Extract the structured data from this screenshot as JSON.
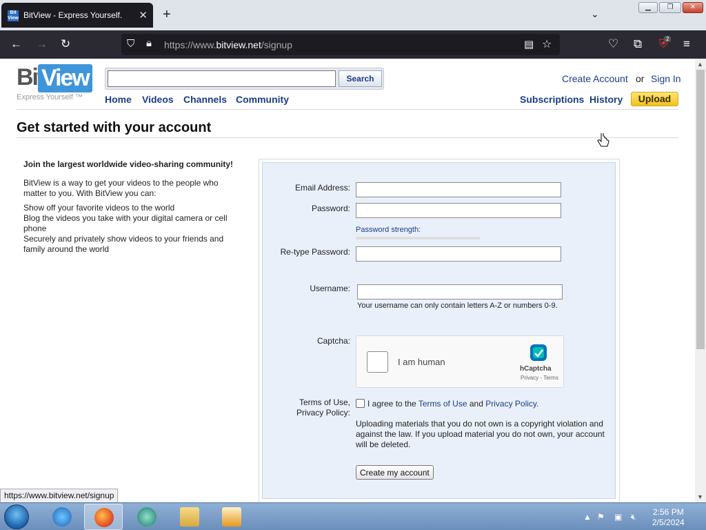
{
  "browser": {
    "tab_title": "BitView - Express Yourself.",
    "favicon_text": "BitView",
    "url_prefix": "https://www.",
    "url_domain": "bitview.net",
    "url_path": "/signup",
    "extension_badge": "2",
    "status_url": "https://www.bitview.net/signup"
  },
  "site": {
    "logo_bit": "Bit",
    "logo_view": "View",
    "logo_tagline": "Express Yourself ™",
    "search_button": "Search",
    "search_value": "",
    "nav": [
      "Home",
      "Videos",
      "Channels",
      "Community"
    ],
    "create_account": "Create Account",
    "or_text": "or",
    "sign_in": "Sign In",
    "subscriptions": "Subscriptions",
    "history": "History",
    "upload": "Upload"
  },
  "page": {
    "title": "Get started with your account",
    "intro_heading": "Join the largest worldwide video-sharing community!",
    "intro_para": "BitView is a way to get your videos to the people who matter to you. With BitView you can:",
    "intro_points": [
      "Show off your favorite videos to the world",
      "Blog the videos you take with your digital camera or cell phone",
      "Securely and privately show videos to your friends and family around the world"
    ]
  },
  "form": {
    "email_label": "Email Address:",
    "password_label": "Password:",
    "password_strength": "Password strength:",
    "retype_label": "Re-type Password:",
    "username_label": "Username:",
    "username_hint": "Your username can only contain letters A-Z or numbers 0-9.",
    "captcha_label": "Captcha:",
    "captcha_text": "I am human",
    "captcha_brand": "hCaptcha",
    "captcha_links": "Privacy - Terms",
    "terms_label_1": "Terms of Use,",
    "terms_label_2": "Privacy Policy:",
    "agree_prefix": "I agree to the",
    "terms_link": "Terms of Use",
    "agree_and": "and",
    "privacy_link": "Privacy Policy.",
    "disclaimer": "Uploading materials that you do not own is a copyright violation and against the law. If you upload material you do not own, your account will be deleted.",
    "submit": "Create my account"
  },
  "taskbar": {
    "time": "2:56 PM",
    "date": "2/5/2024"
  },
  "colors": {
    "link": "#1a3d87",
    "upload_bg": "#f1c21c",
    "form_bg": "#eaf0fa",
    "logo_blue": "#3f95d9"
  }
}
